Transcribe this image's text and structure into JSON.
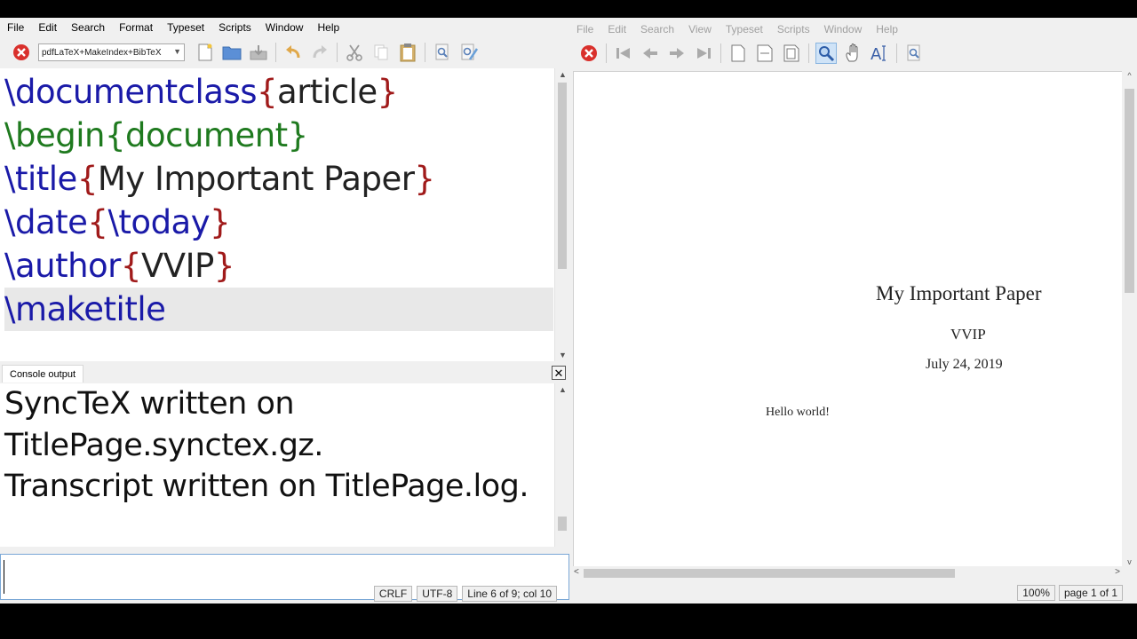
{
  "editor_window": {
    "menu": [
      "File",
      "Edit",
      "Search",
      "Format",
      "Typeset",
      "Scripts",
      "Window",
      "Help"
    ],
    "typeset_engine": "pdfLaTeX+MakeIndex+BibTeX",
    "code_lines": [
      [
        {
          "t": "\\documentclass",
          "c": "kw"
        },
        {
          "t": "{",
          "c": "br"
        },
        {
          "t": "article",
          "c": "txt"
        },
        {
          "t": "}",
          "c": "br"
        }
      ],
      [
        {
          "t": "\\begin",
          "c": "grn"
        },
        {
          "t": "{",
          "c": "grn"
        },
        {
          "t": "document",
          "c": "grn"
        },
        {
          "t": "}",
          "c": "grn"
        }
      ],
      [
        {
          "t": "\\title",
          "c": "kw"
        },
        {
          "t": "{",
          "c": "br"
        },
        {
          "t": "My Important Paper",
          "c": "txt"
        },
        {
          "t": "}",
          "c": "br"
        }
      ],
      [
        {
          "t": "\\date",
          "c": "kw"
        },
        {
          "t": "{",
          "c": "br"
        },
        {
          "t": "\\today",
          "c": "kw"
        },
        {
          "t": "}",
          "c": "br"
        }
      ],
      [
        {
          "t": "\\author",
          "c": "kw"
        },
        {
          "t": "{",
          "c": "br"
        },
        {
          "t": "VVIP",
          "c": "txt"
        },
        {
          "t": "}",
          "c": "br"
        }
      ],
      [
        {
          "t": "\\maketitle",
          "c": "kw"
        }
      ]
    ],
    "current_line": 5,
    "console_tab": "Console output",
    "console_lines": [
      "SyncTeX written on",
      "TitlePage.synctex.gz.",
      "Transcript written on TitlePage.log."
    ],
    "status": {
      "line_ending": "CRLF",
      "encoding": "UTF-8",
      "position": "Line 6 of 9; col 10"
    }
  },
  "preview_window": {
    "menu": [
      "File",
      "Edit",
      "Search",
      "View",
      "Typeset",
      "Scripts",
      "Window",
      "Help"
    ],
    "document": {
      "title": "My Important Paper",
      "author": "VVIP",
      "date": "July 24, 2019",
      "body": "Hello world!"
    },
    "status": {
      "zoom": "100%",
      "page": "page 1 of 1"
    }
  },
  "colors": {
    "keyword": "#1a1aa8",
    "brace": "#a01a1a",
    "env": "#1f7a1f",
    "stop": "#d9302c"
  }
}
